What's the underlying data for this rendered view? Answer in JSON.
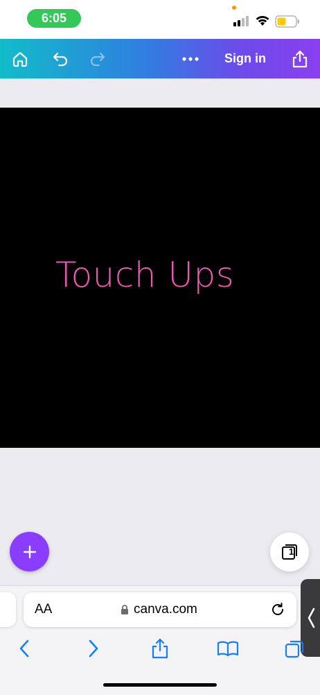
{
  "status_bar": {
    "time": "6:05",
    "icons": [
      "signal-icon",
      "wifi-icon",
      "battery-icon"
    ],
    "battery_color": "#ffcc00",
    "time_pill_color": "#34c759"
  },
  "toolbar": {
    "icons": [
      "home-icon",
      "undo-icon",
      "redo-icon",
      "more-icon",
      "share-icon"
    ],
    "sign_in_label": "Sign in",
    "gradient": [
      "#12bcc9",
      "#2f7fe0",
      "#8a3ff0"
    ]
  },
  "design": {
    "text": "Touch Ups",
    "text_color": "#ec59b4",
    "background": "#000000"
  },
  "editor": {
    "add_icon": "plus-icon",
    "add_color": "#8b3dff",
    "page_count": "1"
  },
  "safari": {
    "text_size_label": "AA",
    "url": "canva.com",
    "icons": [
      "lock-icon",
      "reload-icon",
      "back-icon",
      "forward-icon",
      "share-icon",
      "bookmarks-icon",
      "tabs-icon"
    ]
  }
}
